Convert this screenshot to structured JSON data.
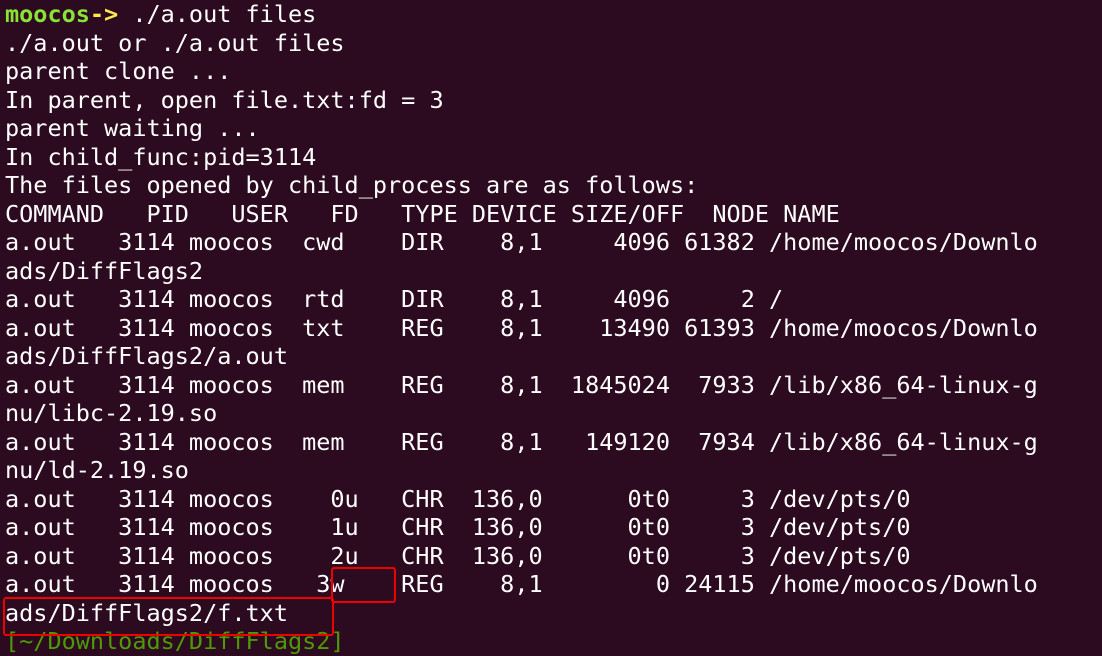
{
  "prompt": {
    "user": "moocos",
    "arrow": "->",
    "command": " ./a.out files"
  },
  "output": {
    "usage": "./a.out or ./a.out files",
    "clone": "parent clone ...",
    "open_file": "In parent, open file.txt:fd = 3",
    "waiting": "parent waiting ...",
    "child_pid": "In child_func:pid=3114",
    "files_header": "The files opened by child_process are as follows:"
  },
  "lsof": {
    "header": "COMMAND   PID   USER   FD   TYPE DEVICE SIZE/OFF  NODE NAME",
    "rows": [
      {
        "text": "a.out   3114 moocos  cwd    DIR    8,1     4096 61382 /home/moocos/Downlo",
        "cont": "ads/DiffFlags2"
      },
      {
        "text": "a.out   3114 moocos  rtd    DIR    8,1     4096     2 /",
        "cont": null
      },
      {
        "text": "a.out   3114 moocos  txt    REG    8,1    13490 61393 /home/moocos/Downlo",
        "cont": "ads/DiffFlags2/a.out"
      },
      {
        "text": "a.out   3114 moocos  mem    REG    8,1  1845024  7933 /lib/x86_64-linux-g",
        "cont": "nu/libc-2.19.so"
      },
      {
        "text": "a.out   3114 moocos  mem    REG    8,1   149120  7934 /lib/x86_64-linux-g",
        "cont": "nu/ld-2.19.so"
      },
      {
        "text": "a.out   3114 moocos    0u   CHR  136,0      0t0     3 /dev/pts/0",
        "cont": null
      },
      {
        "text": "a.out   3114 moocos    1u   CHR  136,0      0t0     3 /dev/pts/0",
        "cont": null
      },
      {
        "text": "a.out   3114 moocos    2u   CHR  136,0      0t0     3 /dev/pts/0",
        "cont": null
      },
      {
        "text": "a.out   3114 moocos   3w    REG    8,1        0 24115 /home/moocos/Downlo",
        "cont": "ads/DiffFlags2/f.txt"
      }
    ]
  },
  "next_prompt": "[~/Downloads/DiffFlags2]",
  "colors": {
    "background": "#2c0a1f",
    "text": "#ffffff",
    "prompt_user": "#8ae234",
    "prompt_arrow": "#fce94f",
    "path_prompt": "#4e9a06",
    "highlight": "#ef0000"
  }
}
